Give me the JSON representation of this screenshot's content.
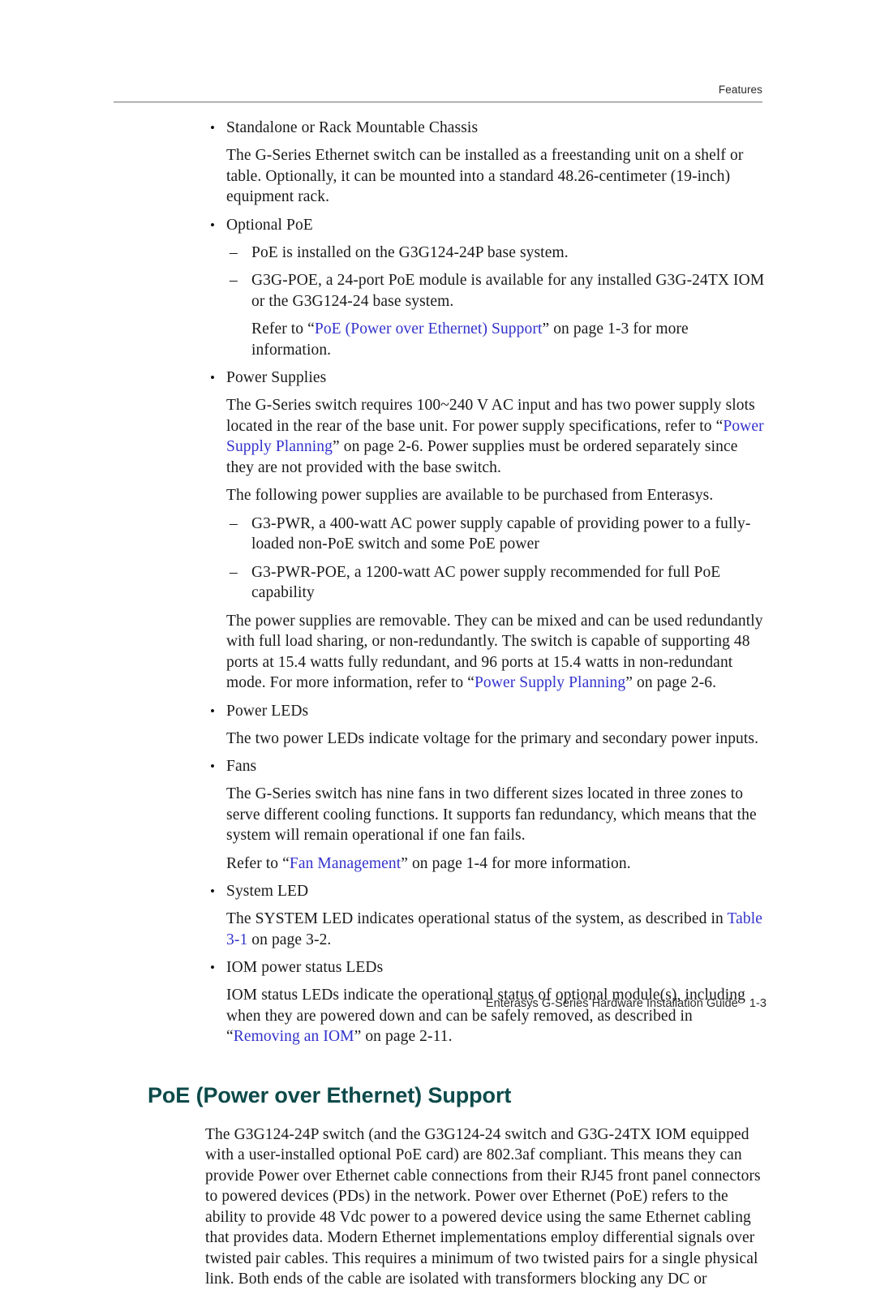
{
  "header": {
    "label": "Features"
  },
  "footer": {
    "guide_title": "Enterasys G-Series Hardware Installation Guide",
    "page_number": "1-3"
  },
  "colors": {
    "heading_teal": "#0d4a4a",
    "xref_blue": "#3232cc",
    "rule_gray": "#9a9a9a",
    "body_text": "#1a1a1a"
  },
  "bullets": {
    "chassis": "Standalone or Rack Mountable Chassis",
    "optional_poe": "Optional PoE",
    "power_supplies": "Power Supplies",
    "power_leds": "Power LEDs",
    "fans": "Fans",
    "system_led": "System LED",
    "iom_leds": "IOM power status LEDs"
  },
  "marks": {
    "bullet": "•",
    "dash": "–"
  },
  "paragraphs": {
    "chassis_body": "The G-Series Ethernet switch can be installed as a freestanding unit on a shelf or table. Optionally, it can be mounted into a standard 48.26-centimeter (19-inch) equipment rack.",
    "poe_dash_1": "PoE is installed on the G3G124-24P base system.",
    "poe_dash_2": "G3G-POE, a 24-port PoE module is available for any installed G3G-24TX IOM or the G3G124-24 base system.",
    "poe_refer_pre": "Refer to “",
    "poe_refer_link": "PoE (Power over Ethernet) Support",
    "poe_refer_post": "” on page 1-3 for more information.",
    "ps_body_1": "The G-Series switch requires 100~240 V AC input and has two power supply slots located in the rear of the base unit. For power supply specifications, refer to “",
    "ps_body_1_link": "Power Supply Planning",
    "ps_body_1_post": "” on page 2-6. Power supplies must be ordered separately since they are not provided with the base switch.",
    "ps_available": "The following power supplies are available to be purchased from Enterasys.",
    "ps_dash_1": "G3-PWR, a 400-watt AC power supply capable of providing power to a fully-loaded non-PoE switch and some PoE power",
    "ps_dash_2": "G3-PWR-POE, a 1200-watt AC power supply recommended for full PoE capability",
    "ps_removable_pre": "The power supplies are removable. They can be mixed and can be used redundantly with full load sharing, or non-redundantly. The switch is capable of supporting 48 ports at 15.4 watts fully redundant, and 96 ports at 15.4 watts in non-redundant mode. For more information, refer to “",
    "ps_removable_link": "Power Supply Planning",
    "ps_removable_post": "” on page 2-6.",
    "power_leds_body": "The two power LEDs indicate voltage for the primary and secondary power inputs.",
    "fans_body": "The G-Series switch has nine fans in two different sizes located in three zones to serve different cooling functions. It supports fan redundancy, which means that the system will remain operational if one fan fails.",
    "fans_refer_pre": "Refer to “",
    "fans_refer_link": "Fan Management",
    "fans_refer_post": "” on page 1-4 for more information.",
    "system_led_pre": "The SYSTEM LED indicates operational status of the system, as described in ",
    "system_led_link": "Table 3-1",
    "system_led_post": " on page 3-2.",
    "iom_leds_pre": "IOM status LEDs indicate the operational status of optional module(s), including when they are powered down and can be safely removed, as described in “",
    "iom_leds_link": "Removing an IOM",
    "iom_leds_post": "” on page 2-11."
  },
  "section": {
    "heading": "PoE (Power over Ethernet) Support",
    "body": "The G3G124-24P switch (and the G3G124-24 switch and G3G-24TX IOM equipped with a user-installed optional PoE card) are 802.3af compliant. This means they can provide Power over Ethernet cable connections from their RJ45 front panel connectors to powered devices (PDs) in the network. Power over Ethernet (PoE) refers to the ability to provide 48 Vdc power to a powered device using the same Ethernet cabling that provides data. Modern Ethernet implementations employ differential signals over twisted pair cables. This requires a minimum of two twisted pairs for a single physical link. Both ends of the cable are isolated with transformers blocking any DC or"
  }
}
